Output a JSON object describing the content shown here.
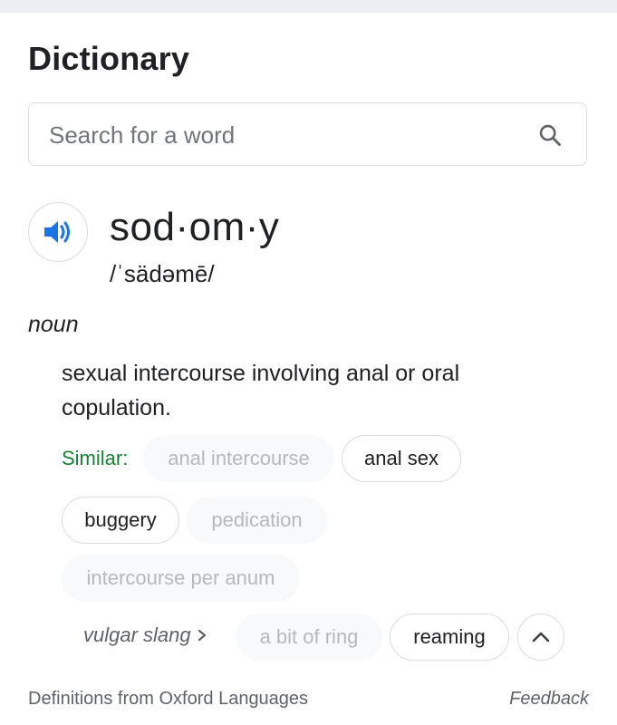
{
  "header": {
    "title": "Dictionary"
  },
  "search": {
    "placeholder": "Search for a word",
    "value": ""
  },
  "entry": {
    "word": "sod·om·y",
    "phonetic": "/ˈsädəmē/",
    "part_of_speech": "noun",
    "definition": "sexual intercourse involving anal or oral copulation.",
    "similar_label": "Similar:",
    "similar": [
      {
        "label": "anal intercourse",
        "state": "faded"
      },
      {
        "label": "anal sex",
        "state": "active"
      },
      {
        "label": "buggery",
        "state": "active"
      },
      {
        "label": "pedication",
        "state": "faded"
      },
      {
        "label": "intercourse per anum",
        "state": "faded"
      }
    ],
    "vulgar_label": "vulgar slang",
    "vulgar_similar": [
      {
        "label": "a bit of ring",
        "state": "faded"
      },
      {
        "label": "reaming",
        "state": "active"
      }
    ]
  },
  "footer": {
    "source": "Definitions from Oxford Languages",
    "feedback": "Feedback"
  },
  "icons": {
    "speaker": "speaker-icon",
    "search": "search-icon",
    "collapse": "chevron-up-icon",
    "vulgar_arrow": "chevron-right-icon"
  },
  "colors": {
    "accent_blue": "#1a73e8",
    "similar_green": "#188038",
    "text_primary": "#202124",
    "text_secondary": "#5f6368"
  }
}
